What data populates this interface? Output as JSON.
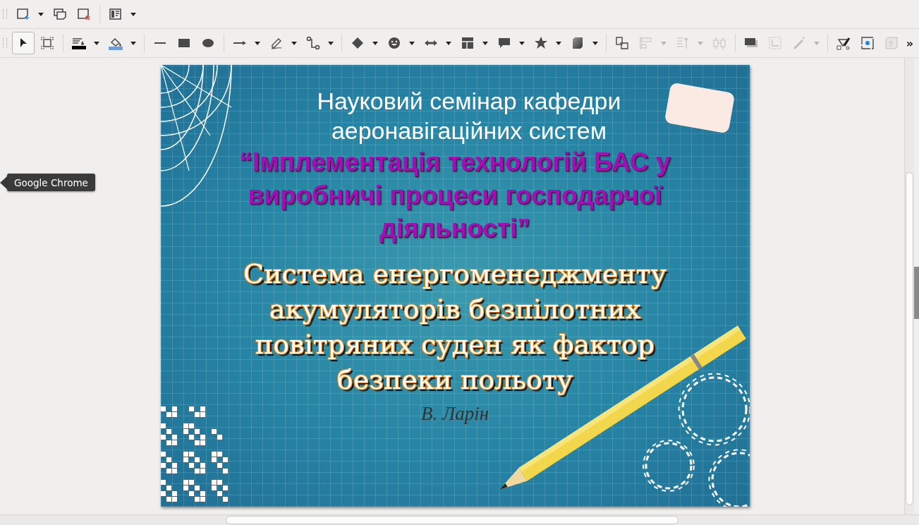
{
  "toolbars": [
    {
      "items": [
        {
          "kind": "new-slide",
          "dropdown": true
        },
        {
          "kind": "duplicate-slide",
          "dropdown": false
        },
        {
          "kind": "delete-slide",
          "dropdown": false
        },
        {
          "kind": "separator"
        },
        {
          "kind": "slide-layout",
          "dropdown": true
        }
      ]
    },
    {
      "items": [
        {
          "kind": "select",
          "dropdown": false,
          "selected": true,
          "disabled": false
        },
        {
          "kind": "zoom-frame",
          "dropdown": false,
          "selected": false,
          "disabled": false
        },
        {
          "kind": "separator"
        },
        {
          "kind": "line-color",
          "dropdown": true,
          "selected": false,
          "disabled": false
        },
        {
          "kind": "fill-color",
          "dropdown": true,
          "selected": false,
          "disabled": false
        },
        {
          "kind": "separator"
        },
        {
          "kind": "line",
          "dropdown": false,
          "selected": false,
          "disabled": false
        },
        {
          "kind": "rectangle",
          "dropdown": false,
          "selected": false,
          "disabled": false
        },
        {
          "kind": "ellipse",
          "dropdown": false,
          "selected": false,
          "disabled": false
        },
        {
          "kind": "separator"
        },
        {
          "kind": "arrow",
          "dropdown": true,
          "selected": false,
          "disabled": false
        },
        {
          "kind": "pencil",
          "dropdown": true,
          "selected": false,
          "disabled": false
        },
        {
          "kind": "connector",
          "dropdown": true,
          "selected": false,
          "disabled": false
        },
        {
          "kind": "separator"
        },
        {
          "kind": "diamond",
          "dropdown": true,
          "selected": false,
          "disabled": false
        },
        {
          "kind": "smiley",
          "dropdown": true,
          "selected": false,
          "disabled": false
        },
        {
          "kind": "double-arrow",
          "dropdown": true,
          "selected": false,
          "disabled": false
        },
        {
          "kind": "grid",
          "dropdown": true,
          "selected": false,
          "disabled": false
        },
        {
          "kind": "speech-bubble",
          "dropdown": true,
          "selected": false,
          "disabled": false
        },
        {
          "kind": "star",
          "dropdown": true,
          "selected": false,
          "disabled": false
        },
        {
          "kind": "cube",
          "dropdown": true,
          "selected": false,
          "disabled": false
        },
        {
          "kind": "separator"
        },
        {
          "kind": "overlap",
          "dropdown": false,
          "selected": false,
          "disabled": false
        },
        {
          "kind": "align-left",
          "dropdown": true,
          "selected": false,
          "disabled": true
        },
        {
          "kind": "align-top",
          "dropdown": true,
          "selected": false,
          "disabled": true
        },
        {
          "kind": "distribute",
          "dropdown": false,
          "selected": false,
          "disabled": true
        },
        {
          "kind": "separator"
        },
        {
          "kind": "shadow",
          "dropdown": false,
          "selected": false,
          "disabled": false
        },
        {
          "kind": "crop",
          "dropdown": false,
          "selected": false,
          "disabled": true
        },
        {
          "kind": "wand",
          "dropdown": true,
          "selected": false,
          "disabled": true
        },
        {
          "kind": "separator"
        },
        {
          "kind": "points",
          "dropdown": false,
          "selected": false,
          "disabled": false
        },
        {
          "kind": "glue-point",
          "dropdown": false,
          "selected": false,
          "disabled": false
        },
        {
          "kind": "extrusion",
          "dropdown": false,
          "selected": false,
          "disabled": true
        }
      ],
      "overflow": "»"
    }
  ],
  "slide": {
    "header": [
      "Науковий семінар кафедри",
      "аеронавігаційних систем"
    ],
    "seminar_title": [
      "“Імплементація технологій БАС у",
      "виробничі процеси господарчої",
      "діяльності”"
    ],
    "talk_title": [
      "Система енергоменеджменту",
      "акумуляторів безпілотних",
      "повітряних суден як фактор",
      "безпеки польоту"
    ],
    "author": "В. Ларін"
  },
  "tooltip": "Google Chrome"
}
